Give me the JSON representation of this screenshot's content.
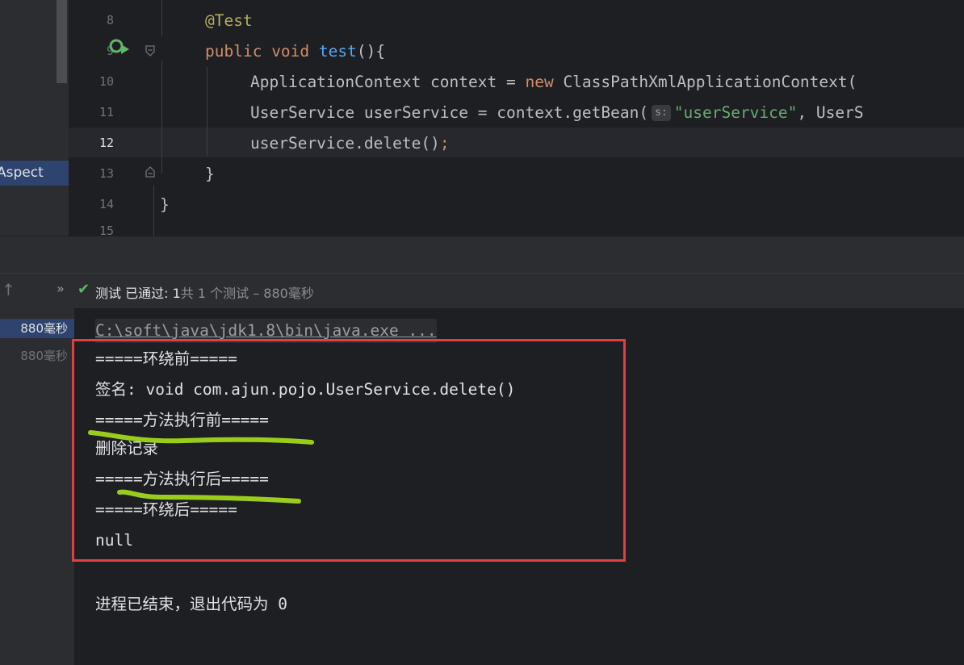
{
  "editor": {
    "side_label": "Aspect",
    "current_line": "12",
    "lines": [
      {
        "num": "8",
        "code": [
          {
            "t": "@Test",
            "c": "annot"
          }
        ]
      },
      {
        "num": "9",
        "code": [
          {
            "t": "public ",
            "c": "kw"
          },
          {
            "t": "void ",
            "c": "kw"
          },
          {
            "t": "test",
            "c": "fn"
          },
          {
            "t": "(){",
            "c": "plain"
          }
        ]
      },
      {
        "num": "10",
        "code": [
          {
            "t": "ApplicationContext context = ",
            "c": "plain"
          },
          {
            "t": "new ",
            "c": "kw"
          },
          {
            "t": "ClassPathXmlApplicationContext(",
            "c": "plain"
          }
        ]
      },
      {
        "num": "11",
        "code": [
          {
            "t": "UserService userService = context.getBean(",
            "c": "plain"
          },
          {
            "t": "s:",
            "c": "hint"
          },
          {
            "t": "\"userService\"",
            "c": "str"
          },
          {
            "t": ", UserS",
            "c": "plain"
          }
        ]
      },
      {
        "num": "12",
        "code": [
          {
            "t": "userService.delete()",
            "c": "plain"
          },
          {
            "t": ";",
            "c": "kw"
          }
        ]
      },
      {
        "num": "13",
        "code": [
          {
            "t": "}",
            "c": "plain"
          }
        ]
      },
      {
        "num": "14",
        "code": [
          {
            "t": "}",
            "c": "plain"
          }
        ]
      },
      {
        "num": "15",
        "code": []
      }
    ]
  },
  "run_toolbar": {
    "more_icon": "double-chevron-right-icon",
    "status_icon": "check-icon",
    "status_text": "测试 已通过: 1",
    "status_detail": "共 1 个测试 – 880毫秒"
  },
  "test_tree": {
    "items": [
      {
        "label": "880毫秒",
        "selected": true
      },
      {
        "label": "880毫秒",
        "selected": false
      }
    ]
  },
  "console": {
    "command": "C:\\soft\\java\\jdk1.8\\bin\\java.exe ...",
    "output": [
      "=====环绕前=====",
      "签名: void com.ajun.pojo.UserService.delete()",
      "=====方法执行前=====",
      "删除记录",
      "=====方法执行后=====",
      "=====环绕后=====",
      "null"
    ],
    "exit_message": "进程已结束，退出代码为 0"
  },
  "colors": {
    "annotation_box": "#e0403f",
    "underline_marker": "#9acd1b",
    "pass_check": "#5fb865"
  }
}
